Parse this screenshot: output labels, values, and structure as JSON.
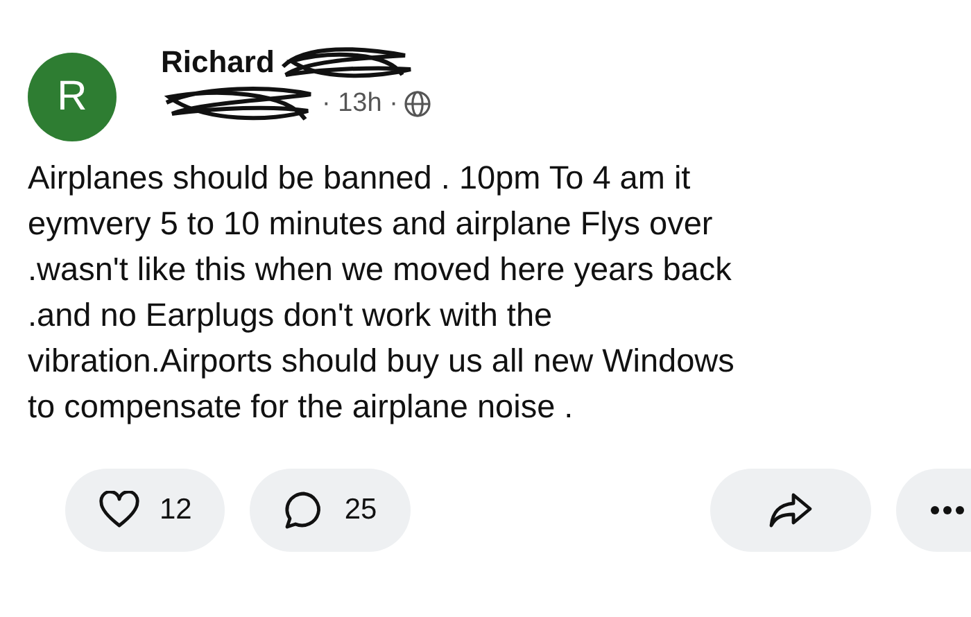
{
  "post": {
    "avatar_letter": "R",
    "author": "Richard",
    "meta": "· 13h ·",
    "body": "Airplanes should be banned . 10pm To 4 am it\neymvery 5 to 10 minutes and airplane Flys over\n.wasn't like this when we moved here years back\n.and no Earplugs don't work with the\nvibration.Airports should buy us all new Windows\nto compensate for the airplane noise ."
  },
  "actions": [
    {
      "kind": "like",
      "count": "12"
    },
    {
      "kind": "comment",
      "count": "25"
    },
    {
      "kind": "share"
    },
    {
      "kind": "more"
    }
  ]
}
